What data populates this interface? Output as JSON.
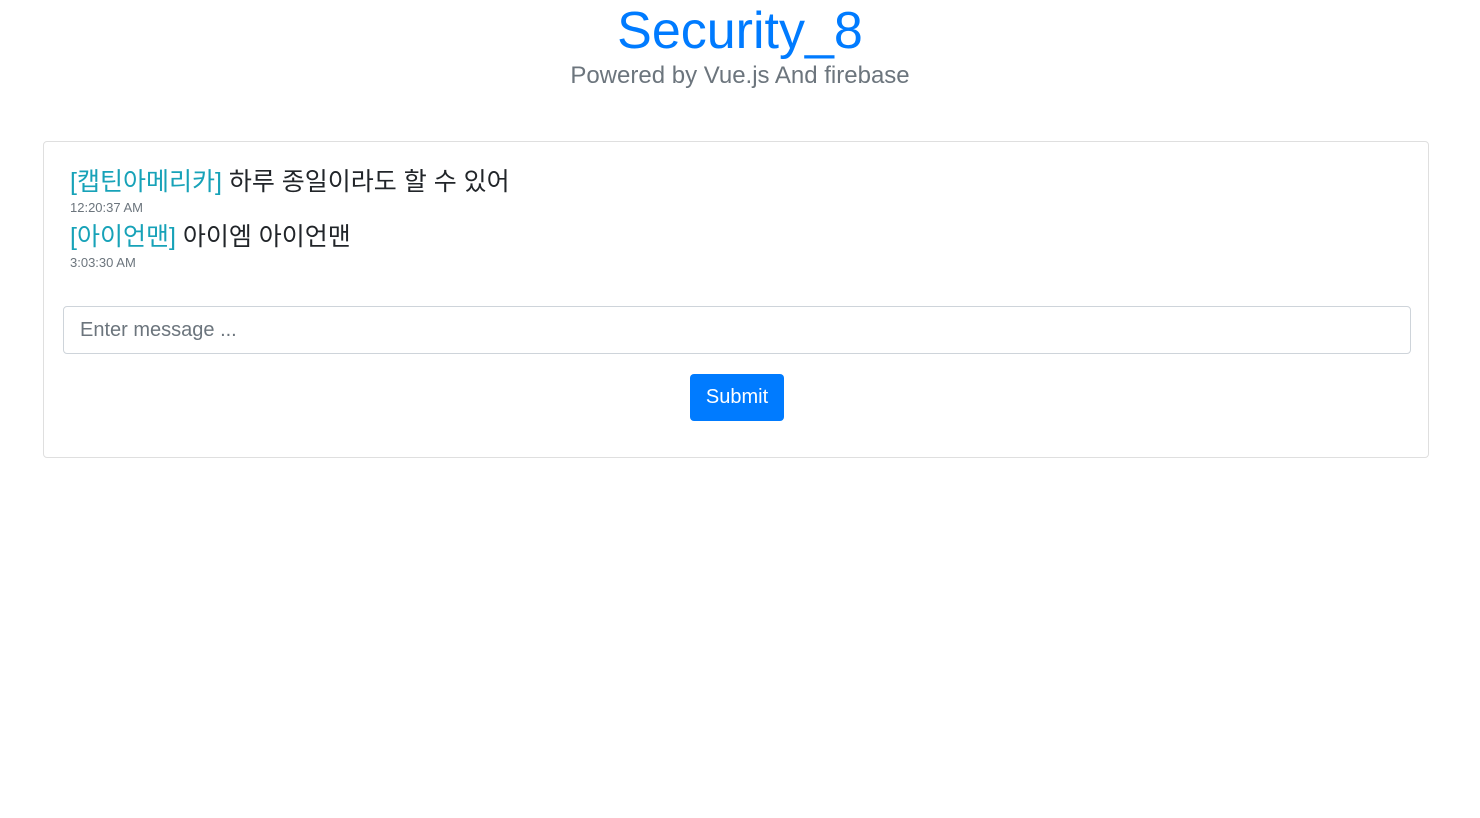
{
  "header": {
    "title": "Security_8",
    "subtitle": "Powered by Vue.js And firebase"
  },
  "messages": [
    {
      "author": "[캡틴아메리카]",
      "text": "하루 종일이라도 할 수 있어",
      "time": "12:20:37 AM"
    },
    {
      "author": "[아이언맨]",
      "text": "아이엠 아이언맨",
      "time": "3:03:30 AM"
    }
  ],
  "form": {
    "input_value": "",
    "input_placeholder": "Enter message ...",
    "submit_label": "Submit"
  },
  "colors": {
    "primary": "#007bff",
    "author": "#17a2b8",
    "muted": "#6c757d"
  }
}
